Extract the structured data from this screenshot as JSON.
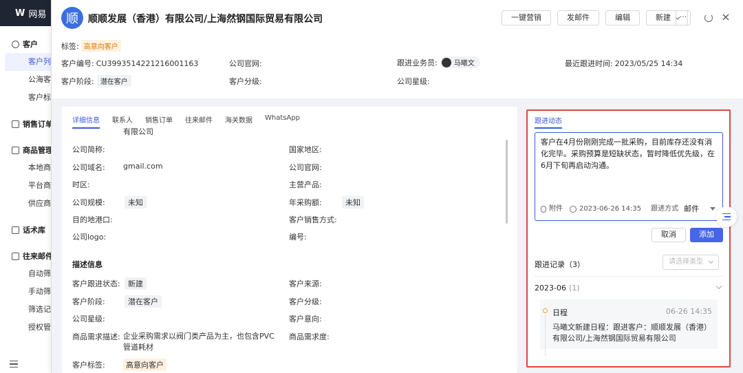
{
  "app": {
    "logo": "W",
    "name": "网易"
  },
  "sidebar": {
    "groups": [
      {
        "label": "客户",
        "items": [
          "客户列表",
          "公海客户",
          "客户标签"
        ]
      },
      {
        "label": "销售订单",
        "items": []
      },
      {
        "label": "商品管理",
        "items": [
          "本地商品",
          "平台商品",
          "供应商管理"
        ]
      },
      {
        "label": "话术库",
        "items": []
      },
      {
        "label": "往来邮件",
        "items": [
          "自动筛选",
          "手动筛选",
          "筛选记录",
          "授权管理"
        ]
      }
    ]
  },
  "header": {
    "avatar_char": "顺",
    "company": "顺顺发展（香港）有限公司/上海然钢国际贸易有限公司",
    "actions": [
      "一键营销",
      "发邮件",
      "编辑",
      "新建"
    ],
    "more": "···",
    "tag_label": "标签:",
    "tag_value": "高意向客户",
    "fields": {
      "customer_no_label": "客户编号:",
      "customer_no": "CU3993514221216001163",
      "website_label": "公司官网:",
      "sales_label": "跟进业务员:",
      "sales_name": "马曦文",
      "last_follow_label": "最近跟进时间:",
      "last_follow": "2023/05/25 14:34",
      "stage_label": "客户阶段:",
      "stage": "潜在客户",
      "grade_label": "客户分级:",
      "star_label": "公司星级:"
    }
  },
  "detail": {
    "tabs": [
      "详细信息",
      "联系人",
      "销售订单",
      "往来邮件",
      "海关数据",
      "WhatsApp"
    ],
    "top_value": "有限公司",
    "basic": {
      "short_name_label": "公司简称:",
      "country_label": "国家地区:",
      "domain_label": "公司域名:",
      "domain": "gmail.com",
      "website_label": "公司官网:",
      "timezone_label": "时区:",
      "main_products_label": "主营产品:",
      "scale_label": "公司规模:",
      "scale": "未知",
      "purchase_label": "年采购额:",
      "purchase": "未知",
      "port_label": "目的地港口:",
      "sales_method_label": "客户销售方式:",
      "logo_label": "公司logo:",
      "code_label": "编号:"
    },
    "desc_title": "描述信息",
    "desc": {
      "status_label": "客户跟进状态:",
      "status": "新建",
      "source_label": "客户来源:",
      "stage_label": "客户阶段:",
      "stage": "潜在客户",
      "grade_label": "客户分级:",
      "star_label": "公司星级:",
      "intent_label": "客户意向:",
      "need_desc_label": "商品需求描述:",
      "need_desc": "企业采购需求以阀门类产品为主，也包含PVC管道耗材",
      "need_level_label": "商品需求度:",
      "tag_label": "客户标签:",
      "tag": "高意向客户"
    }
  },
  "follow": {
    "tab": "跟进动态",
    "text": "客户在4月份刚刚完成一批采购，目前库存还没有消化完毕。采购预算是短缺状态，暂时降低优先级，在6月下旬再启动沟通。",
    "attach_label": "附件",
    "datetime": "2023-06-26 14:35",
    "method_label": "跟进方式",
    "method": "邮件",
    "cancel": "取消",
    "add": "添加",
    "records_label": "跟进记录（3）",
    "type_placeholder": "请选择类型",
    "month": "2023-06",
    "month_count": "(1)",
    "card": {
      "type": "日程",
      "time": "06-26 14:35",
      "desc": "马曦文新建日程：跟进客户：顺顺发展（香港）有限公司/上海然钢国际贸易有限公司"
    }
  }
}
